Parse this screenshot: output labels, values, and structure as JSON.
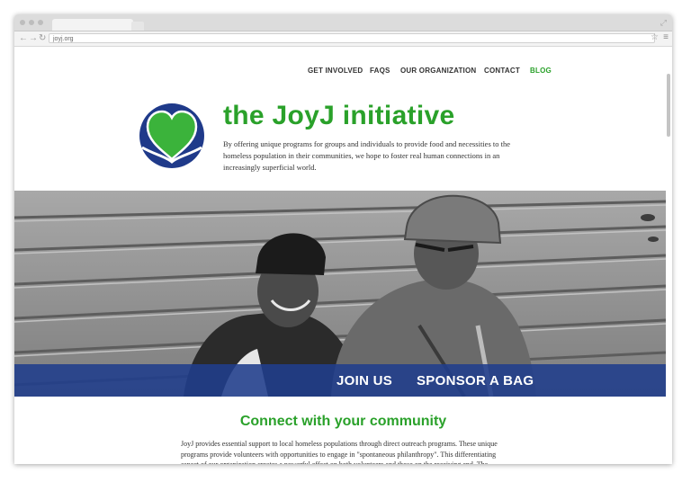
{
  "browser": {
    "url": "joyj.org"
  },
  "nav": {
    "items": [
      {
        "label": "GET INVOLVED"
      },
      {
        "label": "FAQS"
      },
      {
        "label": "OUR ORGANIZATION"
      },
      {
        "label": "CONTACT"
      },
      {
        "label": "BLOG"
      }
    ]
  },
  "header": {
    "title": "the JoyJ initiative",
    "tagline": "By offering unique programs for groups and individuals to provide food and necessities to the homeless population in their communities, we hope to foster real human connections in an increasingly superficial world."
  },
  "hero": {
    "cta_join": "JOIN US",
    "cta_sponsor": "SPONSOR A BAG"
  },
  "main": {
    "heading": "Connect with your community",
    "body": "JoyJ provides essential support to local homeless populations through direct outreach programs. These unique programs provide volunteers with opportunities to engage in \"spontaneous philanthropy\". This differentiating aspect of our organization creates a powerful effect on both volunteers and those on the receiving end. The distribution of our \"comfort bags\" provides not only"
  },
  "colors": {
    "brand_green": "#2aa12a",
    "brand_blue": "#203e8c",
    "nav_text": "#333333"
  },
  "icons": [
    "back-arrow-icon",
    "forward-arrow-icon",
    "reload-icon",
    "star-icon",
    "menu-icon",
    "heart-logo-icon",
    "expand-icon"
  ]
}
